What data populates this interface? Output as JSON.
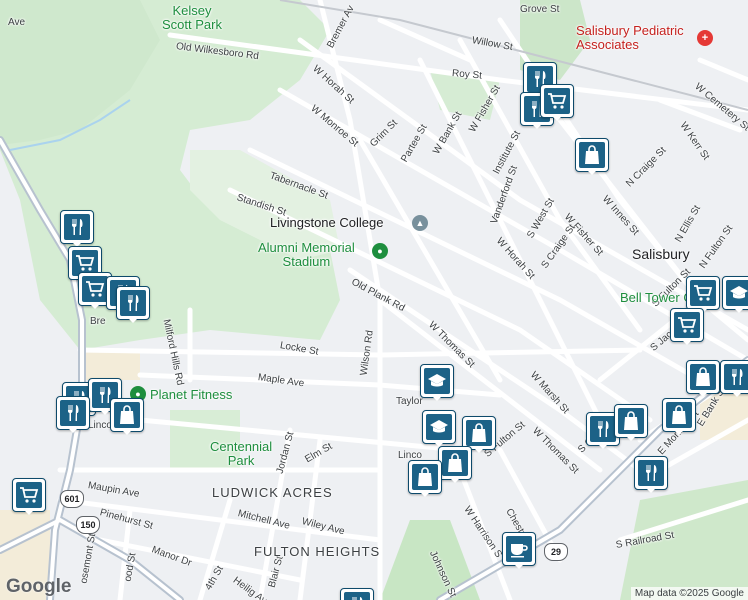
{
  "streets": [
    {
      "name": "Ave",
      "l": 8,
      "t": 17,
      "r": 0
    },
    {
      "name": "Grove St",
      "l": 520,
      "t": 4,
      "r": 0
    },
    {
      "name": "Old Wilkesboro Rd",
      "l": 176,
      "t": 41,
      "r": 7
    },
    {
      "name": "W Horah St",
      "l": 314,
      "t": 62,
      "r": 42
    },
    {
      "name": "Bremer Av",
      "l": 330,
      "t": 42,
      "r": -62
    },
    {
      "name": "Willow St",
      "l": 472,
      "t": 35,
      "r": 10
    },
    {
      "name": "Roy St",
      "l": 452,
      "t": 68,
      "r": 5
    },
    {
      "name": "W Monroe St",
      "l": 312,
      "t": 102,
      "r": 40
    },
    {
      "name": "Grim St",
      "l": 372,
      "t": 140,
      "r": -45
    },
    {
      "name": "Partee St",
      "l": 404,
      "t": 156,
      "r": -60
    },
    {
      "name": "W Bank St",
      "l": 436,
      "t": 148,
      "r": -60
    },
    {
      "name": "W Fisher St",
      "l": 472,
      "t": 126,
      "r": -60
    },
    {
      "name": "Institute St",
      "l": 496,
      "t": 168,
      "r": -62
    },
    {
      "name": "Tabernacle St",
      "l": 270,
      "t": 170,
      "r": 20
    },
    {
      "name": "Standish St",
      "l": 237,
      "t": 192,
      "r": 18
    },
    {
      "name": "Vanderford St",
      "l": 494,
      "t": 218,
      "r": -70
    },
    {
      "name": "S West St",
      "l": 530,
      "t": 232,
      "r": -60
    },
    {
      "name": "W Fisher St",
      "l": 566,
      "t": 210,
      "r": 48
    },
    {
      "name": "W Horah St",
      "l": 498,
      "t": 234,
      "r": 48
    },
    {
      "name": "S Craige St",
      "l": 544,
      "t": 262,
      "r": -55
    },
    {
      "name": "W Innes St",
      "l": 604,
      "t": 192,
      "r": 48
    },
    {
      "name": "N Craige St",
      "l": 628,
      "t": 180,
      "r": -45
    },
    {
      "name": "N Ellis St",
      "l": 678,
      "t": 236,
      "r": -60
    },
    {
      "name": "N Fulton St",
      "l": 702,
      "t": 262,
      "r": -55
    },
    {
      "name": "W Kerr St",
      "l": 682,
      "t": 118,
      "r": 55
    },
    {
      "name": "W Cemetery St",
      "l": 696,
      "t": 80,
      "r": 40
    },
    {
      "name": "Old Plank Rd",
      "l": 352,
      "t": 276,
      "r": 28
    },
    {
      "name": "W Thomas St",
      "l": 430,
      "t": 318,
      "r": 45
    },
    {
      "name": "W Marsh St",
      "l": 532,
      "t": 368,
      "r": 48
    },
    {
      "name": "Milford Hills Rd",
      "l": 166,
      "t": 314,
      "r": 78
    },
    {
      "name": "Locke St",
      "l": 280,
      "t": 340,
      "r": 10
    },
    {
      "name": "Wilson Rd",
      "l": 364,
      "t": 370,
      "r": -82
    },
    {
      "name": "Maple Ave",
      "l": 258,
      "t": 372,
      "r": 8
    },
    {
      "name": "Taylor",
      "l": 396,
      "t": 396,
      "r": 0
    },
    {
      "name": "Linco",
      "l": 398,
      "t": 450,
      "r": 0
    },
    {
      "name": "Lincoln",
      "l": 88,
      "t": 420,
      "r": 0
    },
    {
      "name": "Bre",
      "l": 90,
      "t": 316,
      "r": 0
    },
    {
      "name": "S Fulton St",
      "l": 486,
      "t": 450,
      "r": -40
    },
    {
      "name": "W Thomas St",
      "l": 534,
      "t": 424,
      "r": 45
    },
    {
      "name": "S Church",
      "l": 580,
      "t": 446,
      "r": -45
    },
    {
      "name": "S Jac",
      "l": 652,
      "t": 344,
      "r": -40
    },
    {
      "name": "S Fulton St",
      "l": 654,
      "t": 300,
      "r": -45
    },
    {
      "name": "E Monroe St",
      "l": 660,
      "t": 448,
      "r": -48
    },
    {
      "name": "E Bank S",
      "l": 700,
      "t": 420,
      "r": -58
    },
    {
      "name": "S Railroad St",
      "l": 616,
      "t": 540,
      "r": -10
    },
    {
      "name": "W Harrison S",
      "l": 466,
      "t": 502,
      "r": 56
    },
    {
      "name": "Chestn",
      "l": 508,
      "t": 504,
      "r": 60
    },
    {
      "name": "Johnson St",
      "l": 432,
      "t": 546,
      "r": 65
    },
    {
      "name": "Jordan St",
      "l": 280,
      "t": 468,
      "r": -75
    },
    {
      "name": "Elm St",
      "l": 306,
      "t": 455,
      "r": -30
    },
    {
      "name": "Maupin Ave",
      "l": 88,
      "t": 480,
      "r": 10
    },
    {
      "name": "Pinehurst St",
      "l": 100,
      "t": 507,
      "r": 15
    },
    {
      "name": "Mitchell Ave",
      "l": 238,
      "t": 508,
      "r": 14
    },
    {
      "name": "Wiley Ave",
      "l": 302,
      "t": 516,
      "r": 14
    },
    {
      "name": "Manor Dr",
      "l": 152,
      "t": 544,
      "r": 20
    },
    {
      "name": "Heilig Av",
      "l": 234,
      "t": 574,
      "r": 36
    },
    {
      "name": "Blair St",
      "l": 272,
      "t": 582,
      "r": -75
    },
    {
      "name": "4th St",
      "l": 208,
      "t": 584,
      "r": -60
    },
    {
      "name": "ood St",
      "l": 128,
      "t": 576,
      "r": -80
    },
    {
      "name": "osemont St",
      "l": 84,
      "t": 578,
      "r": -80
    }
  ],
  "places": {
    "kelsey_scott_park": "Kelsey\nScott Park",
    "livingstone_college": "Livingstone College",
    "alumni_memorial_stadium": "Alumni Memorial\nStadium",
    "planet_fitness": "Planet Fitness",
    "centennial_park": "Centennial\nPark",
    "salisbury_pediatric": "Salisbury Pediatric\nAssociates",
    "bell_tower": "Bell Tower Gre",
    "salisbury_city": "Salisbury"
  },
  "neighborhoods": [
    "LUDWICK ACRES",
    "FULTON HEIGHTS"
  ],
  "shields": [
    "601",
    "150",
    "29"
  ],
  "markers": [
    {
      "type": "restaurant",
      "l": 523,
      "t": 62
    },
    {
      "type": "restaurant",
      "l": 520,
      "t": 92
    },
    {
      "type": "cart",
      "l": 540,
      "t": 84
    },
    {
      "type": "bag",
      "l": 575,
      "t": 138
    },
    {
      "type": "restaurant",
      "l": 60,
      "t": 210
    },
    {
      "type": "cart",
      "l": 68,
      "t": 246
    },
    {
      "type": "cart",
      "l": 78,
      "t": 272
    },
    {
      "type": "restaurant",
      "l": 106,
      "t": 276
    },
    {
      "type": "restaurant",
      "l": 116,
      "t": 286
    },
    {
      "type": "restaurant",
      "l": 62,
      "t": 382
    },
    {
      "type": "restaurant",
      "l": 88,
      "t": 378
    },
    {
      "type": "bag",
      "l": 110,
      "t": 398
    },
    {
      "type": "restaurant",
      "l": 56,
      "t": 396
    },
    {
      "type": "cart",
      "l": 12,
      "t": 478
    },
    {
      "type": "school",
      "l": 420,
      "t": 364
    },
    {
      "type": "school",
      "l": 422,
      "t": 410
    },
    {
      "type": "bag",
      "l": 462,
      "t": 416
    },
    {
      "type": "bag",
      "l": 438,
      "t": 446
    },
    {
      "type": "bag",
      "l": 408,
      "t": 460
    },
    {
      "type": "restaurant",
      "l": 586,
      "t": 412
    },
    {
      "type": "bag",
      "l": 614,
      "t": 404
    },
    {
      "type": "bag",
      "l": 662,
      "t": 398
    },
    {
      "type": "restaurant",
      "l": 634,
      "t": 456
    },
    {
      "type": "cart",
      "l": 686,
      "t": 276
    },
    {
      "type": "school",
      "l": 722,
      "t": 276
    },
    {
      "type": "cart",
      "l": 670,
      "t": 308
    },
    {
      "type": "bag",
      "l": 686,
      "t": 360
    },
    {
      "type": "restaurant",
      "l": 720,
      "t": 360
    },
    {
      "type": "cafe",
      "l": 502,
      "t": 532
    },
    {
      "type": "restaurant",
      "l": 340,
      "t": 588
    }
  ],
  "logo": "Google",
  "attribution": "Map data ©2025 Google"
}
